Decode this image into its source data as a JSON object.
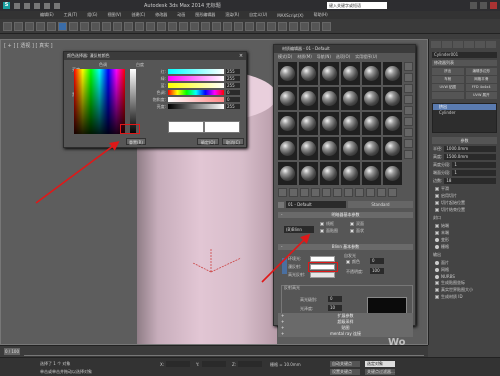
{
  "app": {
    "title": "Autodesk 3ds Max 2014    无标题",
    "search_placeholder": "键入关键字或短语",
    "menus": [
      "编辑(E)",
      "工具(T)",
      "组(G)",
      "视图(V)",
      "创建(C)",
      "修改器",
      "动画",
      "图形编辑器",
      "渲染(R)",
      "自定义(U)",
      "MAXScript(X)",
      "帮助(H)"
    ]
  },
  "viewport": {
    "label": "[ + ] [ 透视 ] [ 真实 ]"
  },
  "command_panel": {
    "object_name": "Cylinder001",
    "modifier_list": "修改器列表",
    "buttons": [
      [
        "挤出",
        "编辑多边形"
      ],
      [
        "车削",
        "网格平滑"
      ],
      [
        "UVW 贴图",
        "FFD 4x4x4"
      ],
      [
        "",
        "UVW 展开"
      ]
    ],
    "stack_selected": "挤出",
    "stack_item": "Cylinder",
    "params_title": "参数",
    "fields": [
      {
        "label": "半径:",
        "value": "1000.0mm"
      },
      {
        "label": "高度:",
        "value": "1500.0mm"
      },
      {
        "label": "高度分段:",
        "value": "1"
      },
      {
        "label": "端面分段:",
        "value": "1"
      },
      {
        "label": "边数:",
        "value": "18"
      }
    ],
    "checks": [
      "平滑",
      "启用切片",
      "切片起始位置",
      "切片结束位置"
    ],
    "caps_title": "封口",
    "caps": [
      "始端",
      "末端"
    ],
    "cap_options": [
      "变形",
      "栅格"
    ],
    "output_title": "输出",
    "output": [
      "面片",
      "网格",
      "NURBS"
    ],
    "gen_map": "生成贴图坐标",
    "real_world": "真实世界贴图大小",
    "gen_mat": "生成材质 ID"
  },
  "timeline": {
    "slider": "0 / 100"
  },
  "status": {
    "selected": "选择了 1 个 对象",
    "hint": "单击或单击并拖动以选择对象",
    "x": "X:",
    "y": "Y:",
    "z": "Z:",
    "grid": "栅格 = 10.0mm",
    "auto_key": "自动关键点",
    "set_key": "设置关键点",
    "filter": "选定对象",
    "key_filter": "关键点过滤器..."
  },
  "color_selector": {
    "title": "颜色选择器: 漫反射颜色",
    "hue": "色调",
    "whiteness": "白度",
    "brightness": "亮度",
    "blackness": "黑度",
    "rows": [
      {
        "label": "红:",
        "value": "255"
      },
      {
        "label": "绿:",
        "value": "255"
      },
      {
        "label": "蓝:",
        "value": "255"
      },
      {
        "label": "色调:",
        "value": "0"
      },
      {
        "label": "饱和度:",
        "value": "0"
      },
      {
        "label": "亮度:",
        "value": "255"
      }
    ],
    "reset_label": "重置(R)",
    "ok_label": "确定(O)",
    "cancel_label": "取消(C)",
    "colors": {
      "new": "#ffffff",
      "old": "#ffffff"
    }
  },
  "material_editor": {
    "title": "材质编辑器 - 01 - Default",
    "menus": [
      "模式(D)",
      "材质(M)",
      "导航(N)",
      "选项(O)",
      "实用程序(U)"
    ],
    "material_name": "01 - Default",
    "material_type": "Standard",
    "shader_rollout": "明暗器基本参数",
    "shader": "(B)Blinn",
    "shader_checks": [
      "线框",
      "双面",
      "面贴图",
      "面状"
    ],
    "blinn_rollout": "Blinn 基本参数",
    "self_illum": "自发光",
    "color_label": "颜色",
    "color_value": "0",
    "ambient": "环境光:",
    "diffuse": "漫反射:",
    "specular": "高光反射:",
    "opacity_label": "不透明度:",
    "opacity_value": "100",
    "highlight_title": "反射高光",
    "spec_level_label": "高光级别:",
    "spec_level": "0",
    "gloss_label": "光泽度:",
    "gloss": "10",
    "soften_label": "柔化:",
    "soften": "0.1",
    "collapsed": [
      "扩展参数",
      "超级采样",
      "贴图",
      "mental ray 连接"
    ],
    "colors": {
      "ambient": "#ffffff",
      "diffuse": "#ffffff",
      "specular": "#e6e6e6"
    }
  },
  "watermark": "Wo"
}
